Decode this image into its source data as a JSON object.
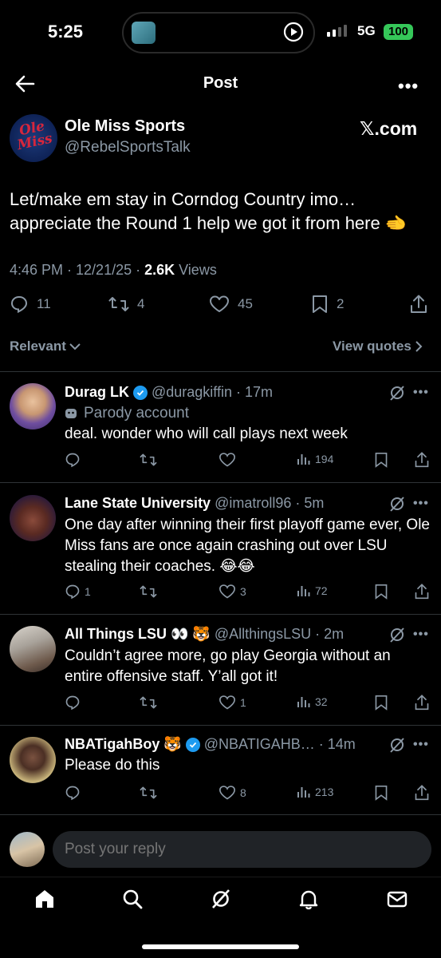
{
  "status": {
    "time": "5:25",
    "network": "5G",
    "battery": "100"
  },
  "header": {
    "title": "Post"
  },
  "post": {
    "author_name": "Ole Miss Sports",
    "author_handle": "@RebelSportsTalk",
    "avatar_logo": "Ole Miss",
    "source": "𝕏.com",
    "text": "Let/make em stay in Corndog Country imo… appreciate the Round 1 help we got it from here 🫲",
    "time": "4:46 PM · 12/21/25 · ",
    "views_count": "2.6K",
    "views_label": " Views",
    "replies": "11",
    "reposts": "4",
    "likes": "45",
    "bookmarks": "2"
  },
  "sort": {
    "relevant_label": "Relevant",
    "view_quotes_label": "View quotes"
  },
  "replies": [
    {
      "name": "Durag LK",
      "verified": true,
      "handle": "@duragkiffin · 17m",
      "parody": "Parody account",
      "text": "deal. wonder who will call plays next week",
      "replies": "",
      "reposts": "",
      "likes": "",
      "views": "194"
    },
    {
      "name": "Lane State University",
      "handle": "@imatroll96 · 5m",
      "text": "One day after winning their first playoff game ever, Ole Miss fans are once again crashing out over LSU stealing their coaches. 😂😂",
      "replies": "1",
      "reposts": "",
      "likes": "3",
      "views": "72"
    },
    {
      "name": "All Things LSU 👀 🐯",
      "handle": "@AllthingsLSU · 2m",
      "text": "Couldn’t agree more, go play Georgia without an entire offensive staff. Y’all got it!",
      "replies": "",
      "reposts": "",
      "likes": "1",
      "views": "32"
    },
    {
      "name": "NBATigahBoy 🐯",
      "verified": true,
      "handle": "@NBATIGAHB… · 14m",
      "text": "Please do this",
      "replies": "",
      "reposts": "",
      "likes": "8",
      "views": "213"
    }
  ],
  "reply_bar": {
    "placeholder": "Post your reply"
  },
  "colors": {
    "accent": "#1d9bf0",
    "muted": "#8b98a5",
    "battery": "#35c759"
  }
}
